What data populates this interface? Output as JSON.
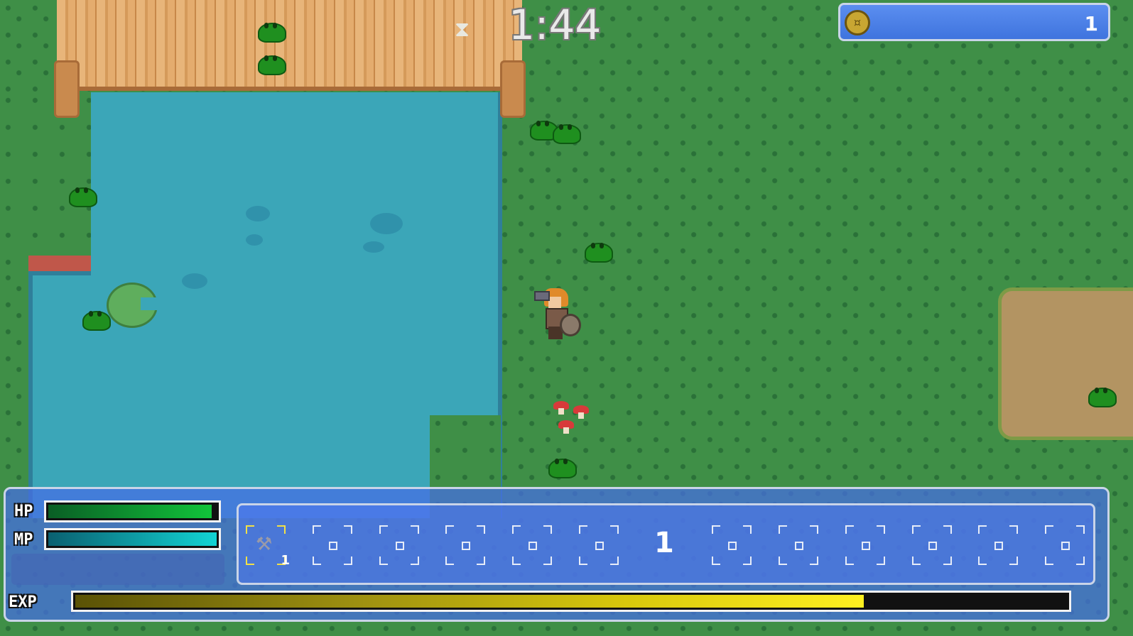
{
  "hud": {
    "timer": "1:44",
    "timer_icon": "hourglass-icon",
    "coins": {
      "icon": "coin-icon",
      "count": "1"
    },
    "hp": {
      "label": "HP",
      "value": 0.97,
      "color": "#11c43a"
    },
    "mp": {
      "label": "MP",
      "value": 1.0,
      "color": "#12d4d4"
    },
    "exp": {
      "label": "EXP",
      "value": 0.795,
      "color": "#f0e41c"
    },
    "level": "1",
    "hotbar": {
      "slots_left": [
        {
          "item": "axe-icon",
          "quantity": "1",
          "selected": true
        },
        {
          "item": "",
          "quantity": ""
        },
        {
          "item": "",
          "quantity": ""
        },
        {
          "item": "",
          "quantity": ""
        },
        {
          "item": "",
          "quantity": ""
        },
        {
          "item": "",
          "quantity": ""
        }
      ],
      "slots_right": [
        {
          "item": "",
          "quantity": ""
        },
        {
          "item": "",
          "quantity": ""
        },
        {
          "item": "",
          "quantity": ""
        },
        {
          "item": "",
          "quantity": ""
        },
        {
          "item": "",
          "quantity": ""
        },
        {
          "item": "",
          "quantity": ""
        }
      ]
    }
  },
  "colors": {
    "grass": "#3f8f47",
    "water": "#3ba6b8",
    "dock": "#e8b57a",
    "hud_panel": "#4f7ee6",
    "slime": "#1f8f1f"
  }
}
